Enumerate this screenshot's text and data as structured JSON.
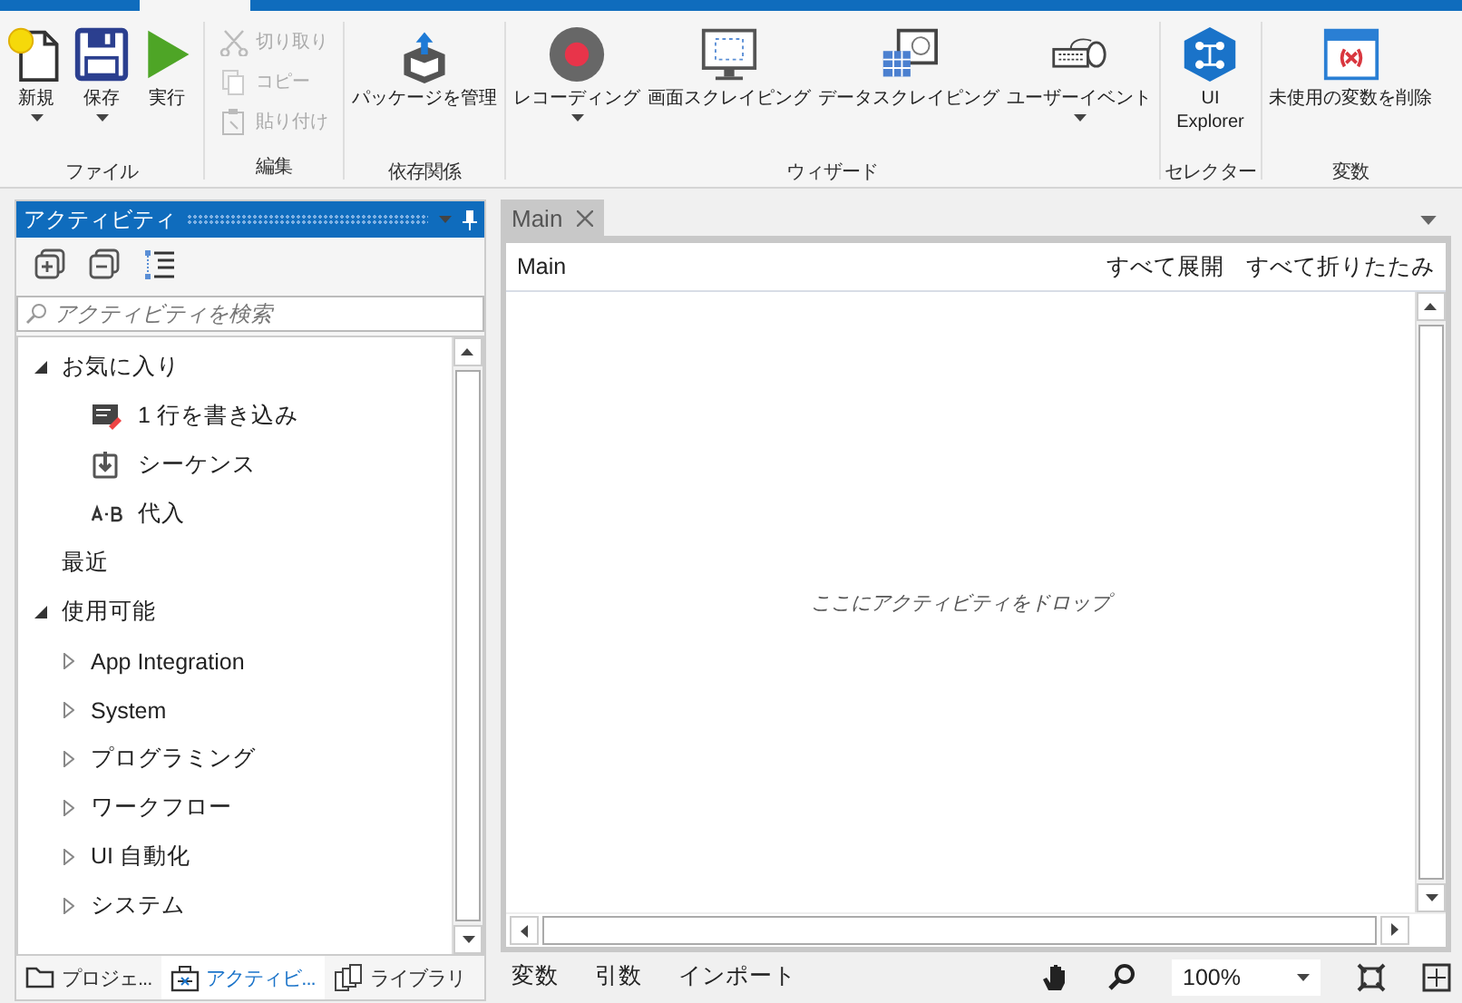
{
  "ribbon": {
    "groups": [
      {
        "label": "ファイル",
        "items": [
          {
            "label": "新規",
            "kind": "large",
            "dropdown": true,
            "disabled": false
          },
          {
            "label": "保存",
            "kind": "large",
            "dropdown": true,
            "disabled": false
          },
          {
            "label": "実行",
            "kind": "large",
            "dropdown": false,
            "disabled": false
          }
        ]
      },
      {
        "label": "編集",
        "items": [
          {
            "label": "切り取り",
            "kind": "small",
            "disabled": true
          },
          {
            "label": "コピー",
            "kind": "small",
            "disabled": true
          },
          {
            "label": "貼り付け",
            "kind": "small",
            "disabled": true
          }
        ]
      },
      {
        "label": "依存関係",
        "items": [
          {
            "label": "パッケージを管理",
            "kind": "large",
            "dropdown": false,
            "disabled": false
          }
        ]
      },
      {
        "label": "ウィザード",
        "items": [
          {
            "label": "レコーディング",
            "kind": "large",
            "dropdown": true,
            "disabled": false
          },
          {
            "label": "画面スクレイピング",
            "kind": "large",
            "dropdown": false,
            "disabled": false
          },
          {
            "label": "データスクレイピング",
            "kind": "large",
            "dropdown": false,
            "disabled": false
          },
          {
            "label": "ユーザーイベント",
            "kind": "large",
            "dropdown": true,
            "disabled": false
          }
        ]
      },
      {
        "label": "セレクター",
        "items": [
          {
            "label": "UI\nExplorer",
            "kind": "large",
            "dropdown": false,
            "disabled": false
          }
        ]
      },
      {
        "label": "変数",
        "items": [
          {
            "label": "未使用の変数を削除",
            "kind": "large",
            "dropdown": false,
            "disabled": false
          }
        ]
      }
    ]
  },
  "activities_panel": {
    "title": "アクティビティ",
    "search": {
      "placeholder": "アクティビティを検索"
    },
    "tree": [
      {
        "label": "お気に入り",
        "kind": "group",
        "expanded": true,
        "children": [
          {
            "label": "1 行を書き込み",
            "kind": "activity"
          },
          {
            "label": "シーケンス",
            "kind": "activity"
          },
          {
            "label": "代入",
            "kind": "activity"
          }
        ]
      },
      {
        "label": "最近",
        "kind": "leaf"
      },
      {
        "label": "使用可能",
        "kind": "group",
        "expanded": true,
        "children": [
          {
            "label": "App Integration",
            "kind": "category",
            "expanded": false
          },
          {
            "label": "System",
            "kind": "category",
            "expanded": false
          },
          {
            "label": "プログラミング",
            "kind": "category",
            "expanded": false
          },
          {
            "label": "ワークフロー",
            "kind": "category",
            "expanded": false
          },
          {
            "label": "UI 自動化",
            "kind": "category",
            "expanded": false
          },
          {
            "label": "システム",
            "kind": "category",
            "expanded": false
          }
        ]
      }
    ],
    "bottom_tabs": [
      {
        "label": "プロジェ...",
        "selected": false
      },
      {
        "label": "アクティビ...",
        "selected": true
      },
      {
        "label": "ライブラリ",
        "selected": false
      }
    ]
  },
  "document": {
    "tabs": [
      {
        "label": "Main",
        "selected": true
      }
    ],
    "breadcrumb": "Main",
    "expand_all": "すべて展開",
    "collapse_all": "すべて折りたたみ",
    "drop_hint": "ここにアクティビティをドロップ",
    "bottom_tabs": [
      "変数",
      "引数",
      "インポート"
    ],
    "zoom": "100%"
  }
}
